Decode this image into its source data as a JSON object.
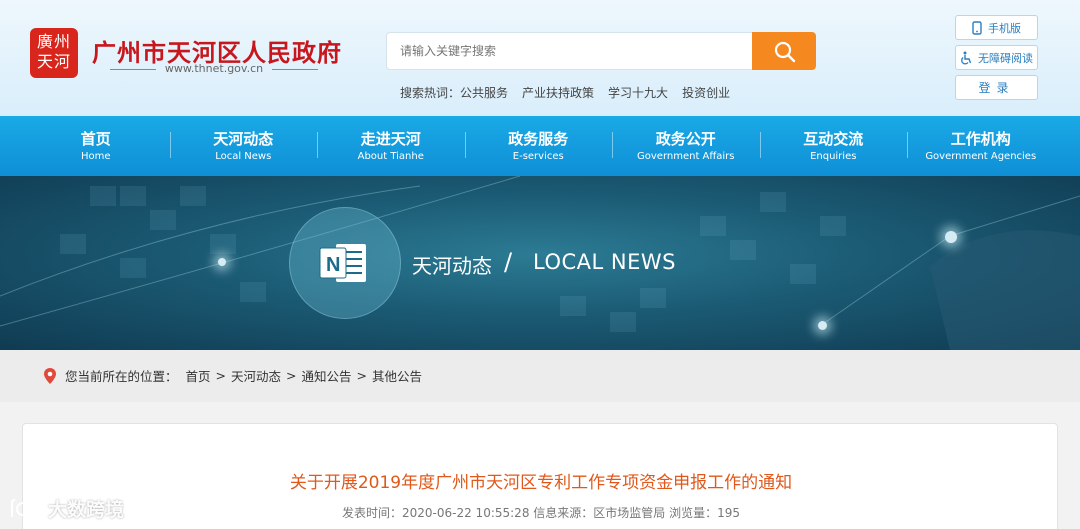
{
  "header": {
    "logo_text": "廣州天河",
    "site_name": "广州市天河区人民政府",
    "site_url": "www.thnet.gov.cn",
    "search_placeholder": "请输入关键字搜索",
    "hot_label": "搜索热词：",
    "hot_words": [
      "公共服务",
      "产业扶持政策",
      "学习十九大",
      "投资创业"
    ],
    "mobile_label": "手机版",
    "access_label": "无障碍阅读",
    "login_label": "登录"
  },
  "nav": [
    {
      "cn": "首页",
      "en": "Home"
    },
    {
      "cn": "天河动态",
      "en": "Local News"
    },
    {
      "cn": "走进天河",
      "en": "About Tianhe"
    },
    {
      "cn": "政务服务",
      "en": "E-services"
    },
    {
      "cn": "政务公开",
      "en": "Government Affairs"
    },
    {
      "cn": "互动交流",
      "en": "Enquiries"
    },
    {
      "cn": "工作机构",
      "en": "Government Agencies"
    }
  ],
  "banner": {
    "title_cn": "天河动态",
    "slash": "/",
    "title_en": "LOCAL NEWS"
  },
  "breadcrumb": {
    "label": "您当前所在的位置：",
    "items": [
      "首页",
      "天河动态",
      "通知公告",
      "其他公告"
    ],
    "separator": ">"
  },
  "article": {
    "title": "关于开展2019年度广州市天河区专利工作专项资金申报工作的通知",
    "meta": "发表时间：2020-06-22 10:55:28   信息来源：区市场监管局  浏览量：195"
  },
  "watermark": "大数跨境",
  "colors": {
    "accent_red": "#c8161d",
    "nav_blue": "#1aa9e6",
    "search_orange": "#f5891f",
    "title_orange": "#e0581b"
  }
}
